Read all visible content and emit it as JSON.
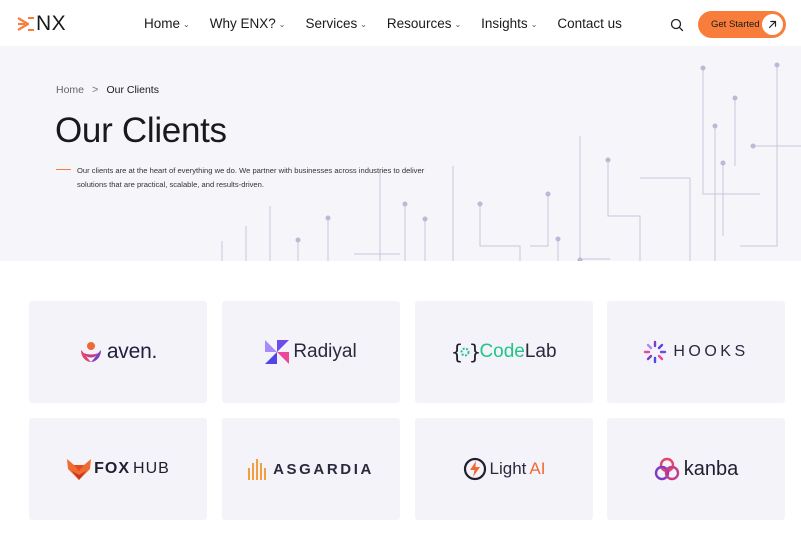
{
  "header": {
    "logo_text": "NX",
    "nav": [
      {
        "label": "Home",
        "has_dropdown": true
      },
      {
        "label": "Why ENX?",
        "has_dropdown": true
      },
      {
        "label": "Services",
        "has_dropdown": true
      },
      {
        "label": "Resources",
        "has_dropdown": true
      },
      {
        "label": "Insights",
        "has_dropdown": true
      },
      {
        "label": "Contact us",
        "has_dropdown": false
      }
    ],
    "search_icon": "search-icon",
    "cta_label": "Get Started",
    "cta_icon": "arrow-up-right-icon",
    "accent_color": "#f97d3a"
  },
  "breadcrumb": {
    "home": "Home",
    "separator": ">",
    "current": "Our Clients"
  },
  "hero": {
    "title": "Our Clients",
    "intro": "Our clients are at the heart of everything we do. We partner with businesses across industries to deliver solutions that are practical, scalable, and results-driven.",
    "background": "#f6f5fa"
  },
  "clients": {
    "aven": {
      "name": "aven."
    },
    "radiyal": {
      "name": "Radiyal"
    },
    "codelab": {
      "part1": "Code",
      "part2": "Lab"
    },
    "hooks": {
      "name": "HOOKS"
    },
    "foxhub": {
      "part1": "FOX",
      "part2": "HUB"
    },
    "asgardia": {
      "name": "ASGARDIA"
    },
    "lightai": {
      "part1": "Light",
      "part2": "AI"
    },
    "kanba": {
      "name": "kanba"
    }
  },
  "card_background": "#f4f3fa"
}
